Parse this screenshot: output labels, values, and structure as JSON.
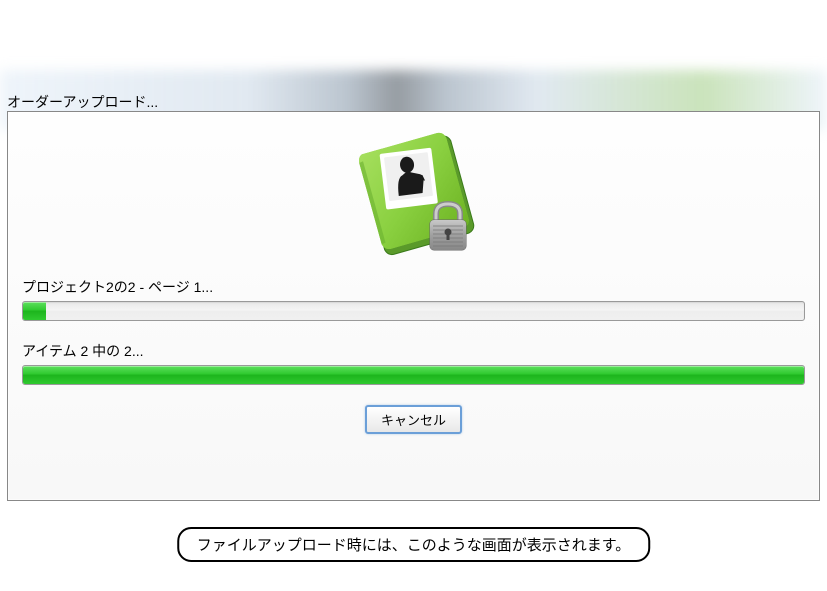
{
  "dialog": {
    "title": "オーダーアップロード...",
    "progress1": {
      "label": "プロジェクト2の2 - ページ 1...",
      "percent": 3
    },
    "progress2": {
      "label": "アイテム 2 中の 2...",
      "percent": 100
    },
    "cancel_label": "キャンセル"
  },
  "caption": "ファイルアップロード時には、このような画面が表示されます。"
}
